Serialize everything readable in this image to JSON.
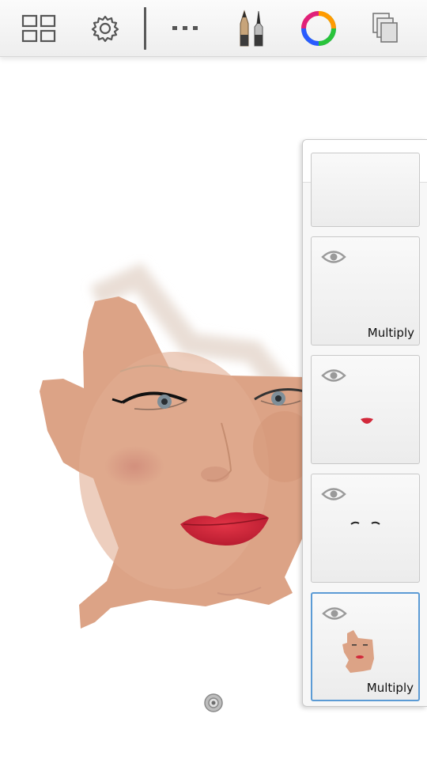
{
  "toolbar": {
    "items": [
      {
        "name": "gallery",
        "icon": "grid-icon"
      },
      {
        "name": "settings",
        "icon": "gear-icon"
      },
      {
        "name": "more",
        "icon": "more-icon"
      },
      {
        "name": "brushes",
        "icon": "brush-icon"
      },
      {
        "name": "color",
        "icon": "color-wheel-icon"
      },
      {
        "name": "layers",
        "icon": "layers-icon"
      }
    ]
  },
  "layer_panel": {
    "add_label": "+",
    "layers": [
      {
        "visible": true,
        "blend_mode": "Multiply"
      },
      {
        "visible": true,
        "blend_mode": ""
      },
      {
        "visible": true,
        "blend_mode": ""
      },
      {
        "visible": true,
        "blend_mode": "Multiply",
        "selected": true
      }
    ]
  },
  "colors": {
    "skin": "#dca386",
    "lips": "#d2283a",
    "iris": "#7e8e98",
    "selection_border": "#5b9bd5"
  }
}
